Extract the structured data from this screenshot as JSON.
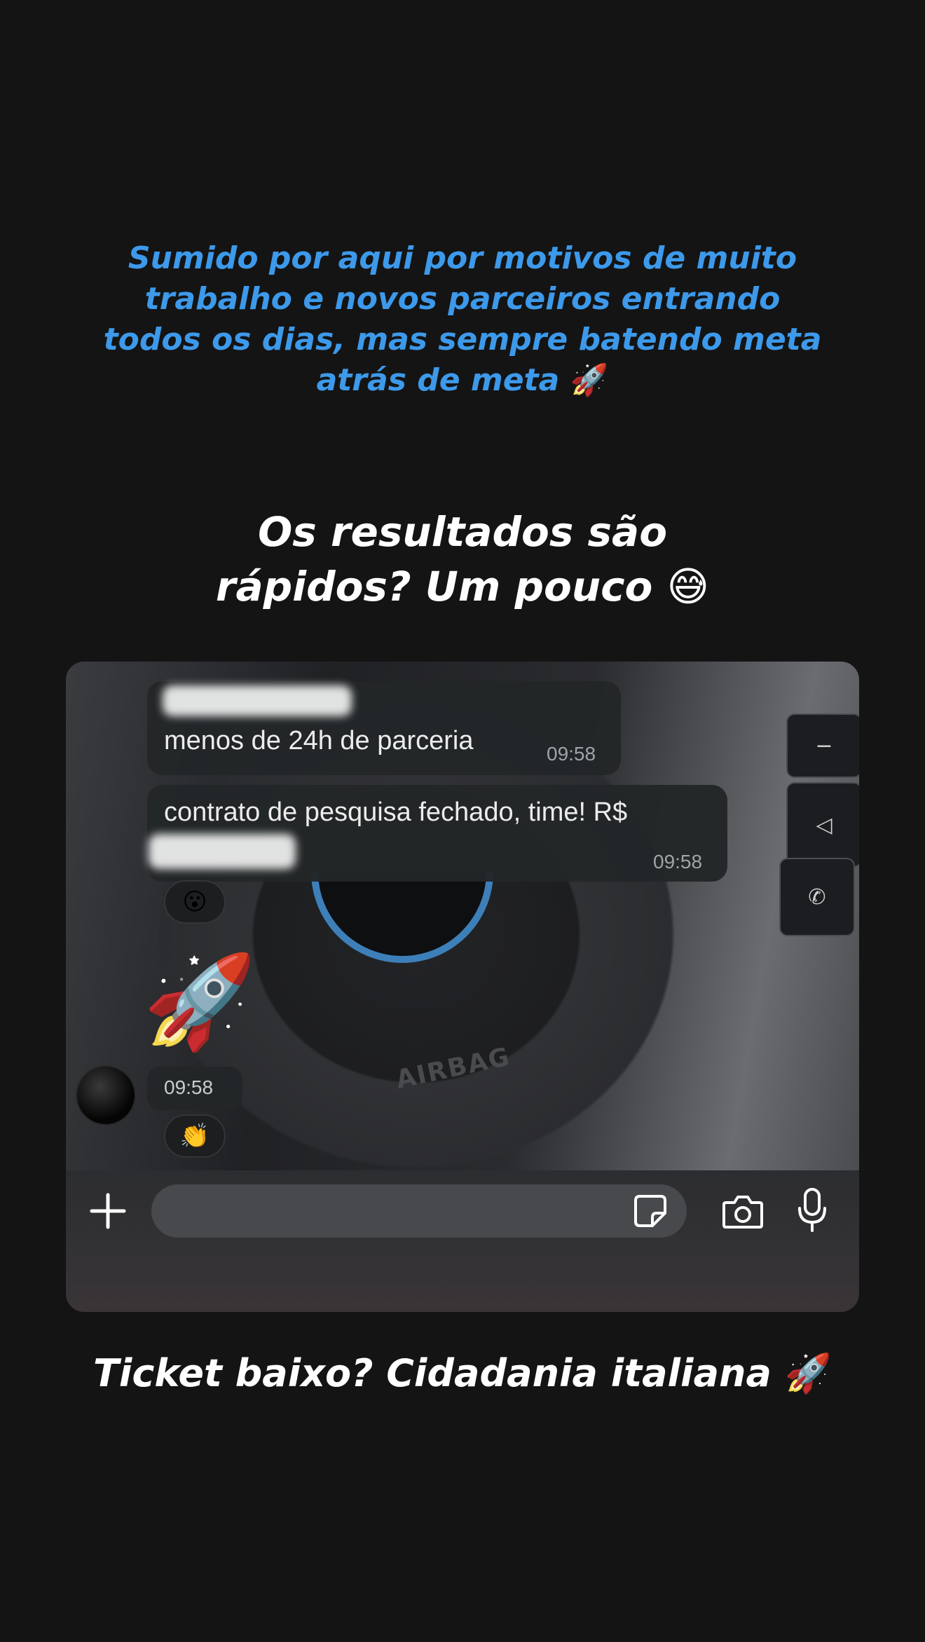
{
  "story": {
    "intro_text": "Sumido por aqui por motivos de muito trabalho e novos parceiros entrando todos os dias, mas sempre batendo meta atrás de meta",
    "intro_emoji": "🚀",
    "headline_text": "Os resultados são rápidos? Um pouco",
    "headline_emoji": "😅",
    "bottom_caption_text": "Ticket baixo? Cidadania italiana",
    "bottom_caption_emoji": "🚀",
    "colors": {
      "background": "#141414",
      "intro_text": "#3d99ea",
      "headline_text": "#ffffff"
    }
  },
  "chat": {
    "messages": [
      {
        "sender_hidden": true,
        "text": "menos de 24h de parceria",
        "time": "09:58"
      },
      {
        "text": "contrato de pesquisa fechado, time! R$",
        "amount_hidden": true,
        "time": "09:58",
        "reaction": "😮"
      },
      {
        "sticker": "🚀",
        "time": "09:58",
        "reaction": "👏"
      }
    ],
    "background_label": "AIRBAG",
    "bubble_color": "#222628"
  },
  "input_bar": {
    "add_icon": "plus-icon",
    "sticker_icon": "sticker-icon",
    "camera_icon": "camera-icon",
    "mic_icon": "microphone-icon",
    "placeholder": ""
  }
}
